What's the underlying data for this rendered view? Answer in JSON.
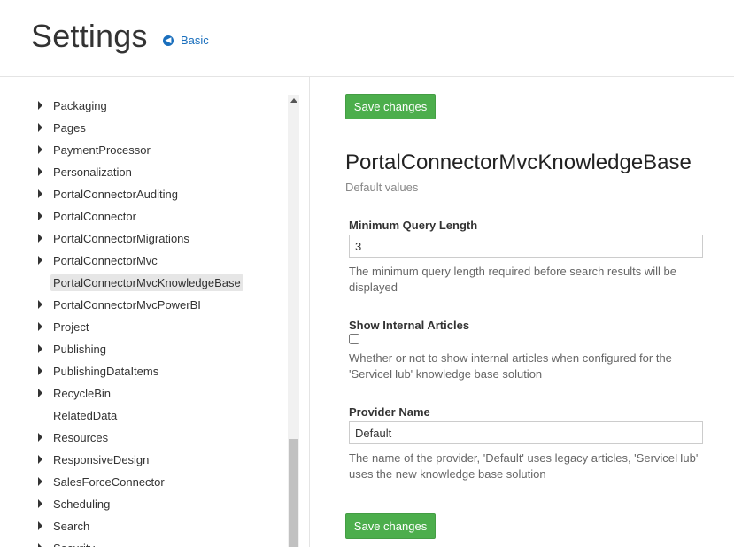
{
  "header": {
    "title": "Settings",
    "back_link": {
      "label": "Basic",
      "icon": "arrow-left-circle-icon"
    }
  },
  "sidebar": {
    "items": [
      {
        "label": "Packaging",
        "expandable": true
      },
      {
        "label": "Pages",
        "expandable": true
      },
      {
        "label": "PaymentProcessor",
        "expandable": true
      },
      {
        "label": "Personalization",
        "expandable": true
      },
      {
        "label": "PortalConnectorAuditing",
        "expandable": true
      },
      {
        "label": "PortalConnector",
        "expandable": true
      },
      {
        "label": "PortalConnectorMigrations",
        "expandable": true
      },
      {
        "label": "PortalConnectorMvc",
        "expandable": true
      },
      {
        "label": "PortalConnectorMvcKnowledgeBase",
        "expandable": false,
        "selected": true
      },
      {
        "label": "PortalConnectorMvcPowerBI",
        "expandable": true
      },
      {
        "label": "Project",
        "expandable": true
      },
      {
        "label": "Publishing",
        "expandable": true
      },
      {
        "label": "PublishingDataItems",
        "expandable": true
      },
      {
        "label": "RecycleBin",
        "expandable": true
      },
      {
        "label": "RelatedData",
        "expandable": false
      },
      {
        "label": "Resources",
        "expandable": true
      },
      {
        "label": "ResponsiveDesign",
        "expandable": true
      },
      {
        "label": "SalesForceConnector",
        "expandable": true
      },
      {
        "label": "Scheduling",
        "expandable": true
      },
      {
        "label": "Search",
        "expandable": true
      },
      {
        "label": "Security",
        "expandable": true
      }
    ]
  },
  "main": {
    "save_label": "Save changes",
    "section_title": "PortalConnectorMvcKnowledgeBase",
    "section_subtitle": "Default values",
    "fields": {
      "min_query": {
        "label": "Minimum Query Length",
        "value": "3",
        "help": "The minimum query length required before search results will be displayed"
      },
      "internal_articles": {
        "label": "Show Internal Articles",
        "checked": false,
        "help": "Whether or not to show internal articles when configured for the 'ServiceHub' knowledge base solution"
      },
      "provider_name": {
        "label": "Provider Name",
        "value": "Default",
        "help": "The name of the provider, 'Default' uses legacy articles, 'ServiceHub' uses the new knowledge base solution"
      }
    }
  },
  "colors": {
    "accent": "#1a6fbd",
    "save_button": "#4cae4c",
    "selected_item_bg": "#e6e6e6"
  }
}
